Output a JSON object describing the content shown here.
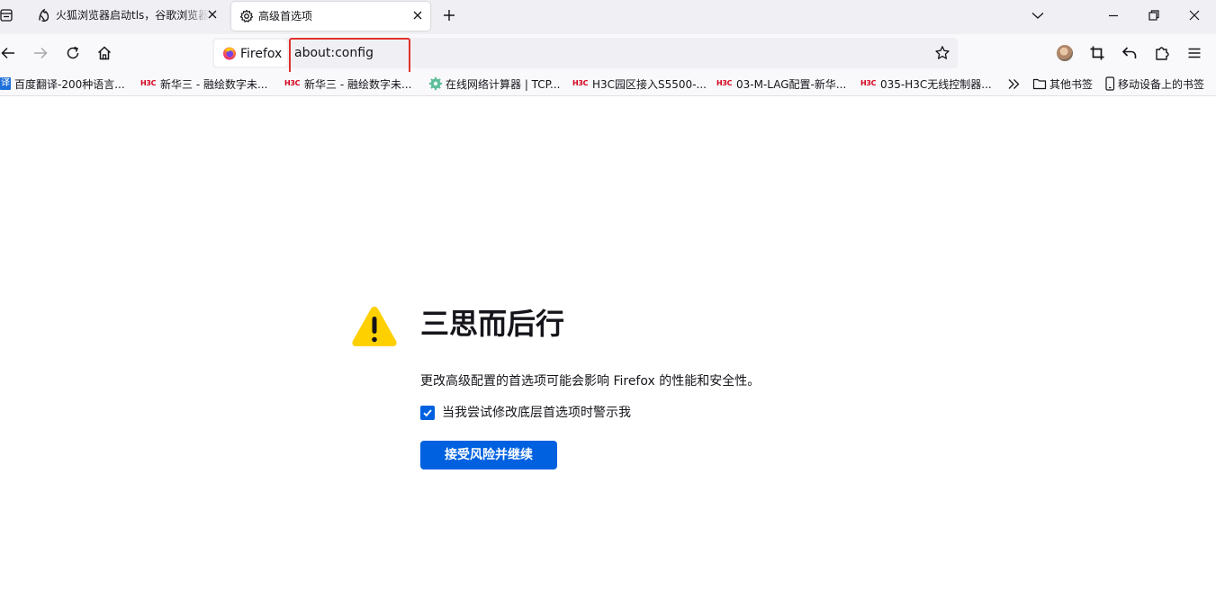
{
  "tabs": [
    {
      "title": "火狐浏览器启动tls，谷歌浏览器",
      "icon": "fox-app-icon",
      "active": false
    },
    {
      "title": "高级首选项",
      "icon": "gear-icon",
      "active": true
    }
  ],
  "navbar": {
    "identity_label": "Firefox",
    "url": "about:config"
  },
  "bookmarks": [
    {
      "label": "百度翻译-200种语言...",
      "icon": "translate-icon",
      "icon_text": "译"
    },
    {
      "label": "新华三 - 融绘数字未...",
      "icon": "h3c-logo-icon",
      "icon_text": "H3C"
    },
    {
      "label": "新华三 - 融绘数字未...",
      "icon": "h3c-logo-icon",
      "icon_text": "H3C"
    },
    {
      "label": "在线网络计算器 | TCP...",
      "icon": "gear-green-icon"
    },
    {
      "label": "H3C园区接入S5500-...",
      "icon": "h3c-logo-icon",
      "icon_text": "H3C"
    },
    {
      "label": "03-M-LAG配置-新华...",
      "icon": "h3c-logo-icon",
      "icon_text": "H3C"
    },
    {
      "label": "035-H3C无线控制器...",
      "icon": "h3c-logo-icon",
      "icon_text": "H3C"
    }
  ],
  "bookmarks_other": "其他书签",
  "bookmarks_mobile": "移动设备上的书签",
  "content": {
    "title": "三思而后行",
    "warning_text": "更改高级配置的首选项可能会影响 Firefox 的性能和安全性。",
    "checkbox_label": "当我尝试修改底层首选项时警示我",
    "checkbox_checked": true,
    "accept_button": "接受风险并继续"
  },
  "colors": {
    "accent": "#0061e0",
    "warning": "#ffd000",
    "highlight": "#e0312b"
  }
}
